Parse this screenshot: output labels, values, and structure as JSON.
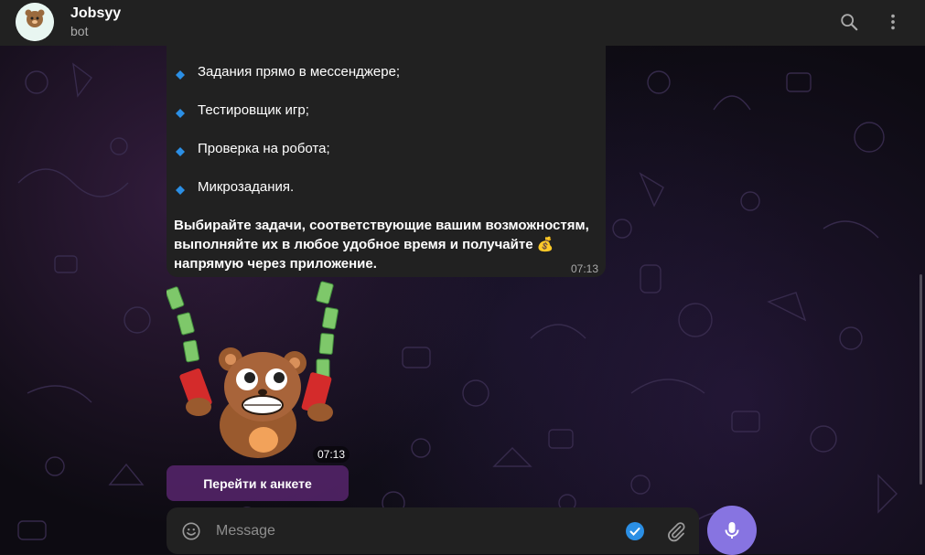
{
  "header": {
    "name": "Jobsyy",
    "status": "bot",
    "avatar_text": "Jobsyy",
    "icons": [
      "search-icon",
      "more-vertical-icon"
    ]
  },
  "message": {
    "list_items": [
      "Задания прямо в мессенджере;",
      "Тестировщик игр;",
      "Проверка на робота;",
      "Микрозадания."
    ],
    "paragraph_part1": "Выбирайте задачи, соответствующие вашим возможностям, выполняйте их в любое удобное время и получайте",
    "paragraph_emoji": "💰",
    "paragraph_part2": "напрямую через приложение.",
    "time": "07:13"
  },
  "sticker": {
    "time": "07:13"
  },
  "inline_button": {
    "label": "Перейти к анкете"
  },
  "composer": {
    "placeholder": "Message",
    "icons": [
      "emoji-icon",
      "check-icon",
      "attach-icon",
      "microphone-icon"
    ]
  },
  "colors": {
    "accent": "#8774e1",
    "header_bg": "#212121",
    "bubble_bg": "#212121",
    "bullet": "#2b8fe5"
  }
}
